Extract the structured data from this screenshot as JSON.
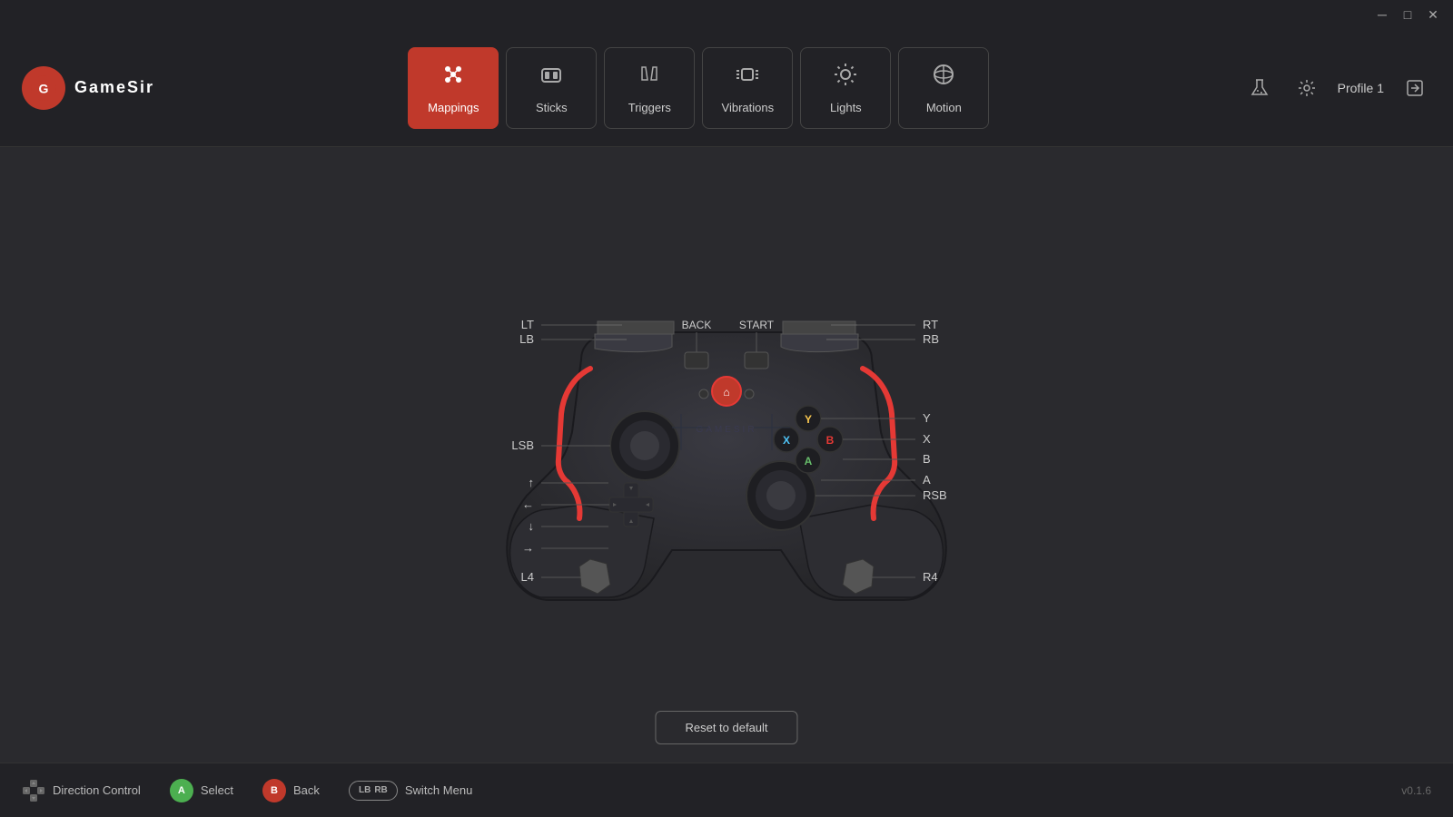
{
  "app": {
    "title": "GameSir",
    "logo_letter": "G",
    "version": "v0.1.6"
  },
  "titlebar": {
    "minimize": "─",
    "maximize": "□",
    "close": "✕"
  },
  "nav": {
    "tabs": [
      {
        "id": "mappings",
        "label": "Mappings",
        "icon": "⊕",
        "active": true
      },
      {
        "id": "sticks",
        "label": "Sticks",
        "icon": "◎",
        "active": false
      },
      {
        "id": "triggers",
        "label": "Triggers",
        "icon": "▱",
        "active": false
      },
      {
        "id": "vibrations",
        "label": "Vibrations",
        "icon": "〜",
        "active": false
      },
      {
        "id": "lights",
        "label": "Lights",
        "icon": "✦",
        "active": false
      },
      {
        "id": "motion",
        "label": "Motion",
        "icon": "⟳",
        "active": false
      }
    ]
  },
  "header_right": {
    "profile_label": "Profile 1",
    "icon1": "⚗",
    "icon2": "⚙"
  },
  "controller": {
    "labels_left": [
      {
        "id": "LB",
        "text": "LB"
      },
      {
        "id": "LT",
        "text": "LT"
      },
      {
        "id": "LSB",
        "text": "LSB"
      },
      {
        "id": "UP",
        "text": "↑"
      },
      {
        "id": "LEFT",
        "text": "←"
      },
      {
        "id": "DOWN",
        "text": "↓"
      },
      {
        "id": "RIGHT",
        "text": "→"
      },
      {
        "id": "L4",
        "text": "L4"
      }
    ],
    "labels_right": [
      {
        "id": "RB",
        "text": "RB"
      },
      {
        "id": "RT",
        "text": "RT"
      },
      {
        "id": "X",
        "text": "X"
      },
      {
        "id": "Y",
        "text": "Y"
      },
      {
        "id": "B",
        "text": "B"
      },
      {
        "id": "A",
        "text": "A"
      },
      {
        "id": "RSB",
        "text": "RSB"
      },
      {
        "id": "R4",
        "text": "R4"
      }
    ],
    "labels_top": [
      {
        "id": "BACK",
        "text": "BACK"
      },
      {
        "id": "START",
        "text": "START"
      }
    ]
  },
  "buttons": {
    "reset_to_default": "Reset to default"
  },
  "bottom_bar": {
    "hints": [
      {
        "icon_type": "dpad",
        "text": "Direction Control"
      },
      {
        "icon_type": "A_green",
        "text": "Select"
      },
      {
        "icon_type": "B_red",
        "text": "Back"
      },
      {
        "icon_type": "LB_RB",
        "text": "Switch Menu"
      }
    ],
    "version": "v0.1.6"
  }
}
